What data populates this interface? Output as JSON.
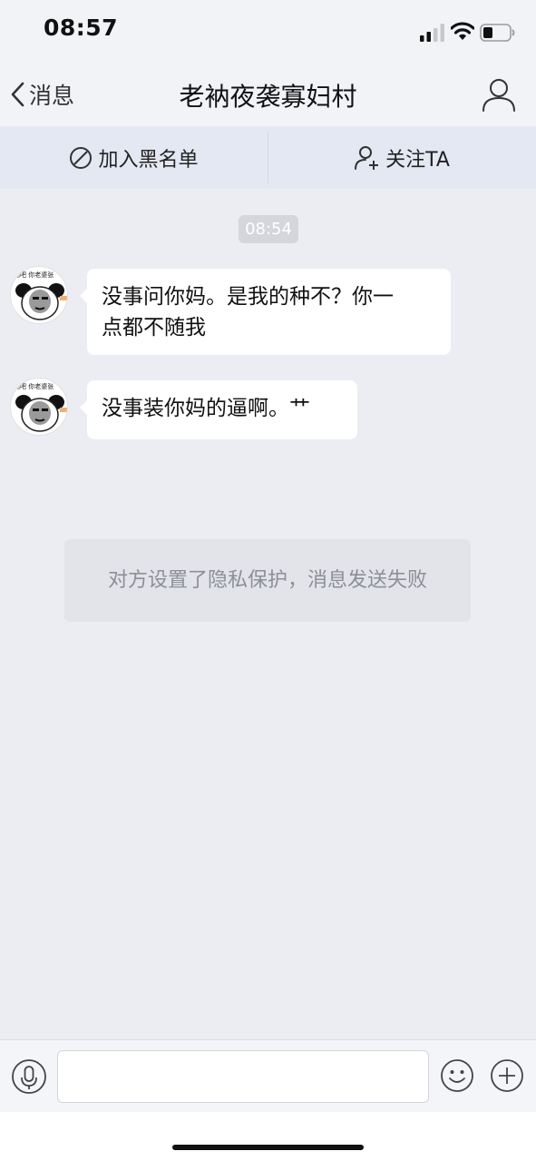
{
  "status_bar": {
    "time": "08:57"
  },
  "nav": {
    "back_label": "消息",
    "title": "老衲夜袭寡妇村"
  },
  "actions": {
    "block_label": "加入黑名单",
    "follow_label": "关注TA"
  },
  "chat": {
    "timestamp": "08:54",
    "avatar_caption": "摇吧 你老婆张",
    "messages": [
      {
        "text_line1": "没事问你妈。是我的种不？你一",
        "text_line2": "点都不随我"
      },
      {
        "text": "没事装你妈的逼啊。艹"
      }
    ],
    "system_notice": "对方设置了隐私保护，消息发送失败"
  },
  "input": {
    "value": "",
    "placeholder": ""
  },
  "icons": {
    "back": "chevron-left-icon",
    "profile": "user-icon",
    "block": "prohibit-icon",
    "follow": "add-user-icon",
    "voice": "microphone-icon",
    "emoji": "smiley-icon",
    "more": "plus-icon"
  }
}
